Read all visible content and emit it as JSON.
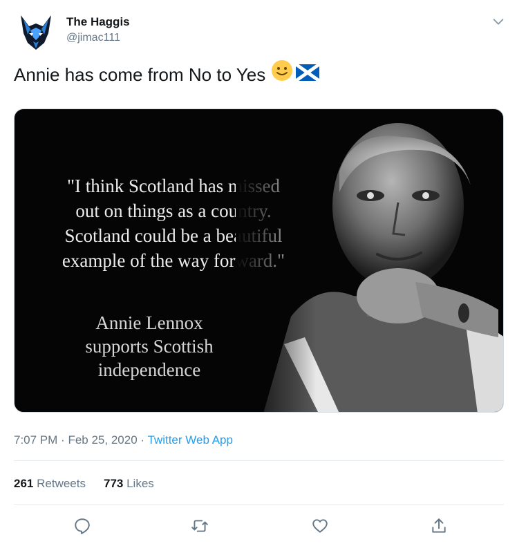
{
  "author": {
    "name": "The Haggis",
    "handle": "@jimac111"
  },
  "tweet": {
    "text": "Annie has come from No to Yes",
    "emojis": [
      "slightly-smiling-face-icon",
      "scotland-flag-icon"
    ]
  },
  "media": {
    "quote_lines": [
      "\"I think Scotland has missed",
      "out on things as a country.",
      "Scotland could be a beautiful",
      "example of the way forward.\""
    ],
    "attribution_lines": [
      "Annie Lennox",
      "supports Scottish",
      "independence"
    ]
  },
  "meta": {
    "time": "7:07 PM",
    "sep": "·",
    "date": "Feb 25, 2020",
    "source": "Twitter Web App"
  },
  "stats": {
    "retweets_count": "261",
    "retweets_label": "Retweets",
    "likes_count": "773",
    "likes_label": "Likes"
  },
  "actions": [
    "reply-icon",
    "retweet-icon",
    "like-icon",
    "share-icon"
  ],
  "colors": {
    "link": "#1da1f2",
    "secondary": "#657786",
    "text": "#14171a",
    "divider": "#e6ecf0"
  }
}
